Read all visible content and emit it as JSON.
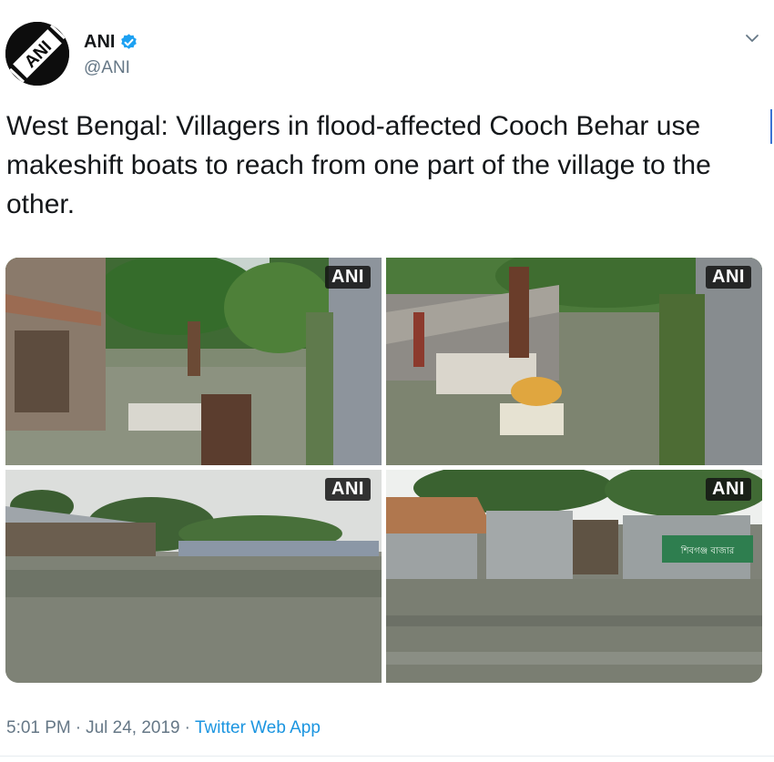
{
  "author": {
    "display_name": "ANI",
    "handle": "@ANI",
    "avatar_text": "ANI",
    "verified_icon": "verified-badge-icon"
  },
  "menu_icon": "chevron-down-icon",
  "tweet": {
    "text": "West Bengal: Villagers in flood-affected Cooch Behar use makeshift boats to reach from one part of the village to the other."
  },
  "media": {
    "watermark": "ANI",
    "photos": [
      {
        "watermark": "ANI"
      },
      {
        "watermark": "ANI"
      },
      {
        "watermark": "ANI"
      },
      {
        "watermark": "ANI",
        "sign_text": "শিবগঞ্জ বাজার"
      }
    ]
  },
  "meta": {
    "time": "5:01 PM",
    "separator": "·",
    "date": "Jul 24, 2019",
    "source": "Twitter Web App"
  },
  "colors": {
    "link": "#1b95e0",
    "muted": "#657786",
    "verified": "#1da1f2"
  }
}
